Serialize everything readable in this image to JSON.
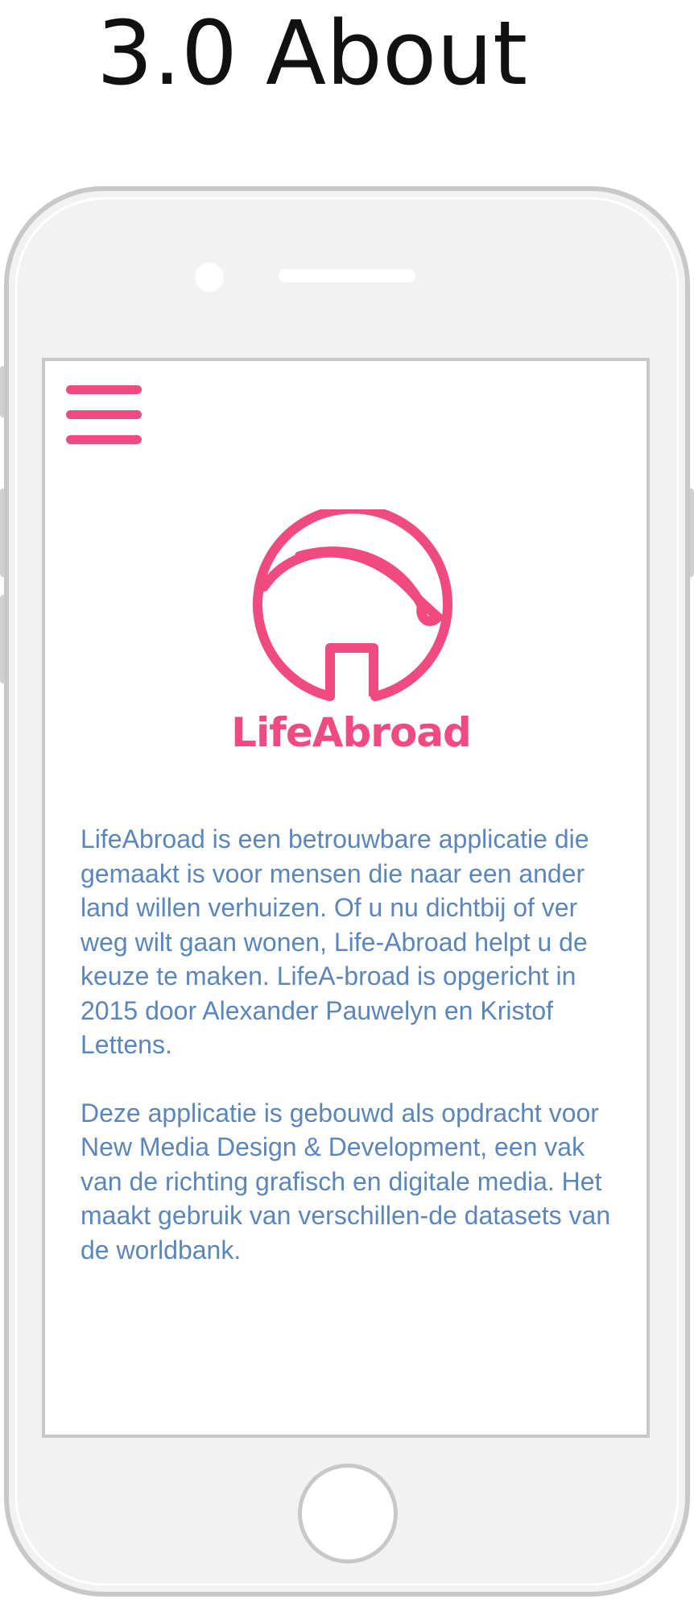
{
  "page": {
    "heading": "3.0 About"
  },
  "app": {
    "brand_name": "LifeAbroad",
    "menu_icon": "hamburger-menu-icon",
    "logo_icon": "house-arc-logo-icon",
    "accent_color": "#f04b80",
    "text_color": "#5b86bb",
    "paragraphs": [
      "LifeAbroad is een betrouwbare applicatie die gemaakt is voor mensen die naar een ander land willen verhuizen. Of u nu dichtbij of ver weg wilt gaan wonen, Life-Abroad helpt u de keuze te maken. LifeA-broad is opgericht in 2015 door Alexander Pauwelyn en Kristof Lettens.",
      "Deze applicatie is gebouwd als opdracht voor New Media Design & Development, een vak van de richting grafisch en digitale media. Het maakt gebruik van verschillen-de datasets van de worldbank."
    ]
  }
}
